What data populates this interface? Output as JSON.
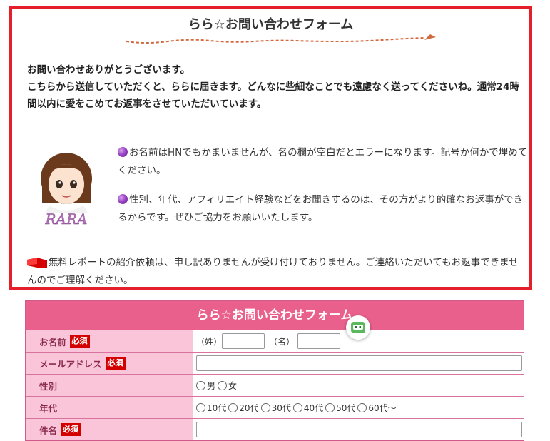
{
  "notice": {
    "title": "らら☆お問い合わせフォーム",
    "intro_line1": "お問い合わせありがとうございます。",
    "intro_line2": "こちらから送信していただくと、ららに届きます。どんなに些細なことでも遠慮なく送ってくださいね。通常24時間以内に愛をこめてお返事をさせていただいています。",
    "note1": "お名前はHNでもかまいませんが、名の欄が空白だとエラーになります。記号か何かで埋めてください。",
    "note2": "性別、年代、アフィリエイト経験などをお聞きするのは、その方がより的確なお返事ができるからです。ぜひご協力をお願いいたします。",
    "note3": "無料レポートの紹介依頼は、申し訳ありませんが受け付けておりません。ご連絡いただいてもお返事できませんのでご理解ください。",
    "avatar_label": "RARA"
  },
  "form": {
    "title": "らら☆お問い合わせフォーム",
    "required_badge": "必須",
    "name_label": "お名前",
    "surname_caption": "（姓）",
    "given_caption": "（名）",
    "email_label": "メールアドレス",
    "gender_label": "性別",
    "gender_options": [
      "男",
      "女"
    ],
    "age_label": "年代",
    "age_options": [
      "10代",
      "20代",
      "30代",
      "40代",
      "50代",
      "60代〜"
    ],
    "subject_label": "件名"
  },
  "colors": {
    "notice_border": "#e51f2a",
    "form_header": "#e9608c",
    "label_bg": "#fbc5d9",
    "required_bg": "#d40000"
  },
  "icons": [
    "purple-dot-icon",
    "red-flag-icon",
    "chat-bot-icon"
  ]
}
